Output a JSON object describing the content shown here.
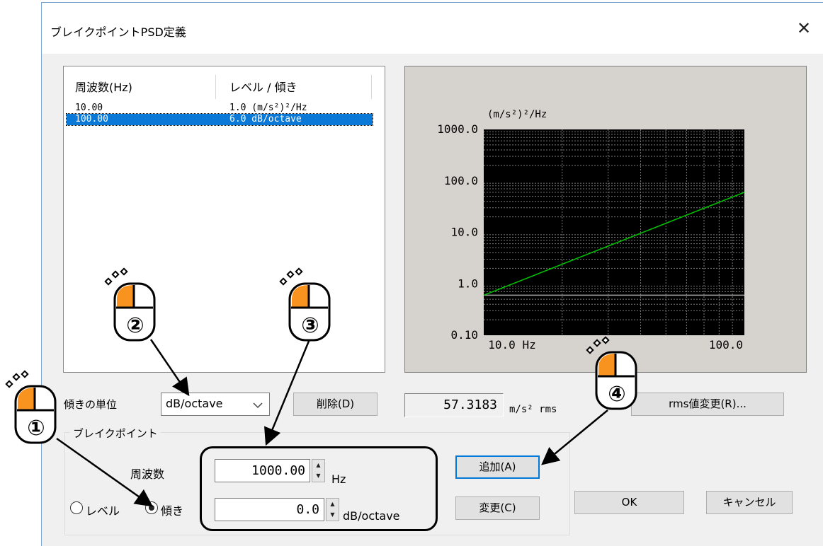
{
  "window": {
    "title": "ブレイクポイントPSD定義",
    "close_glyph": "✕"
  },
  "list": {
    "columns": [
      "周波数(Hz)",
      "レベル / 傾き"
    ],
    "rows": [
      {
        "freq": "10.00",
        "value": "1.0 (m/s²)²/Hz",
        "selected": false
      },
      {
        "freq": "100.00",
        "value": "6.0  dB/octave",
        "selected": true
      }
    ]
  },
  "chart_data": {
    "type": "line",
    "title": "",
    "xlabel": "",
    "ylabel": "",
    "y_unit_label": "(m/s²)²/Hz",
    "x_scale": "log",
    "y_scale": "log",
    "xlim": [
      10,
      100
    ],
    "ylim": [
      0.1,
      1000
    ],
    "x_tick_labels": [
      "10.0 Hz",
      "100.0"
    ],
    "y_tick_labels": [
      "1000.0",
      "100.0",
      "10.0",
      "1.0",
      "0.10"
    ],
    "series": [
      {
        "x": [
          10,
          100
        ],
        "y": [
          0.6,
          60
        ]
      }
    ],
    "reference_line_y": 0.6,
    "grid": true,
    "colors": {
      "plot_bg": "#000000",
      "line": "#00c800",
      "grid": "#7a7a7a"
    }
  },
  "controls": {
    "slope_unit_label": "傾きの単位",
    "slope_unit_value": "dB/octave",
    "delete_button": "削除(D)",
    "rms_value": "57.3183",
    "rms_unit": "m/s² rms",
    "rms_change_button": "rms値変更(R)...",
    "group_label": "ブレイクポイント",
    "freq_label": "周波数",
    "freq_value": "1000.00",
    "freq_unit": "Hz",
    "slope_value": "0.0",
    "slope_unit": "dB/octave",
    "radio_level": "レベル",
    "radio_slope": "傾き",
    "add_button": "追加(A)",
    "change_button": "変更(C)",
    "ok_button": "OK",
    "cancel_button": "キャンセル"
  },
  "callouts": [
    "①",
    "②",
    "③",
    "④"
  ],
  "colors": {
    "accent": "#0078d7",
    "mouse_orange": "#f7931e",
    "selection": "#0a78d7"
  }
}
